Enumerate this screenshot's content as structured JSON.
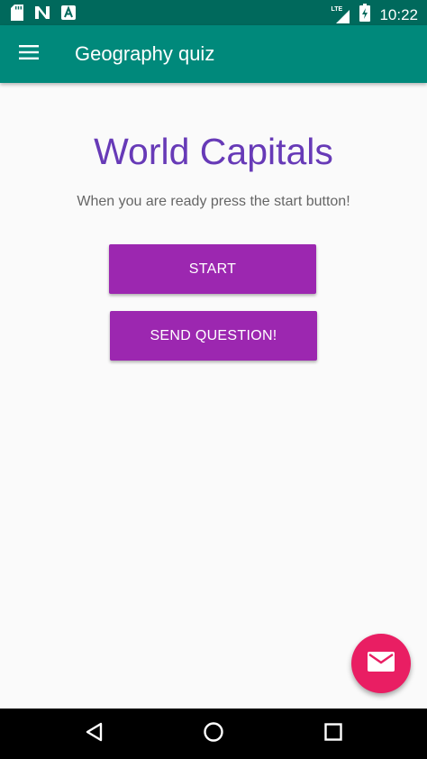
{
  "status_bar": {
    "time": "10:22",
    "network_label": "LTE",
    "icons": [
      "sd-card-icon",
      "n-notification-icon",
      "a-notification-icon",
      "signal-icon",
      "battery-icon"
    ]
  },
  "app_bar": {
    "title": "Geography quiz",
    "menu_icon": "hamburger-menu-icon"
  },
  "main": {
    "heading": "World Capitals",
    "subtitle": "When you are ready press the start button!",
    "start_button": "START",
    "send_button": "SEND QUESTION!"
  },
  "fab": {
    "icon": "mail-icon"
  },
  "nav_bar": {
    "icons": [
      "back-icon",
      "home-icon",
      "recents-icon"
    ]
  },
  "colors": {
    "status_bar": "#00695c",
    "app_bar": "#00897b",
    "heading": "#673ab7",
    "button": "#9c27b0",
    "fab": "#e91e63",
    "background": "#fafafa"
  }
}
